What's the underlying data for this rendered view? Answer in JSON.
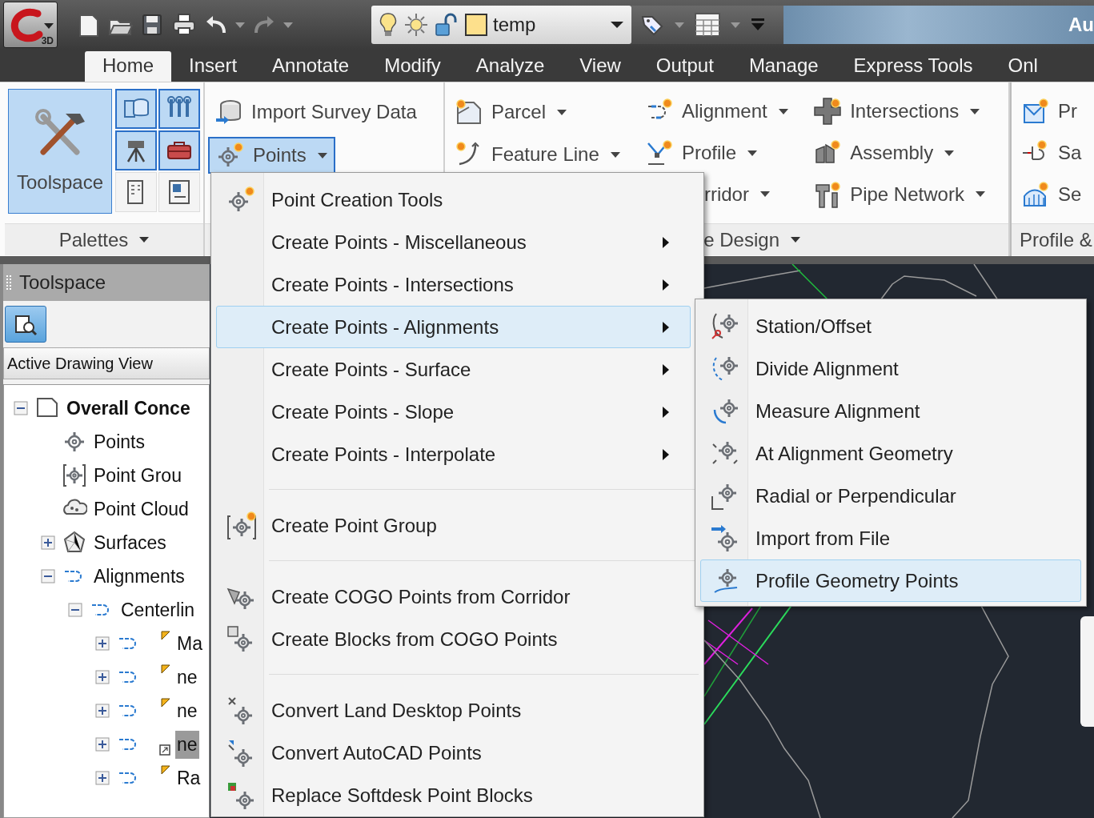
{
  "title_bar": {
    "app_button": {
      "badge": "3D"
    },
    "layer": {
      "name": "temp"
    },
    "title": "Au"
  },
  "ribbon": {
    "tabs": [
      {
        "label": "Home",
        "selected": true
      },
      {
        "label": "Insert",
        "selected": false
      },
      {
        "label": "Annotate",
        "selected": false
      },
      {
        "label": "Modify",
        "selected": false
      },
      {
        "label": "Analyze",
        "selected": false
      },
      {
        "label": "View",
        "selected": false
      },
      {
        "label": "Output",
        "selected": false
      },
      {
        "label": "Manage",
        "selected": false
      },
      {
        "label": "Express Tools",
        "selected": false
      },
      {
        "label": "Onl",
        "selected": false
      }
    ],
    "palettes_panel": {
      "toolspace": {
        "label": "Toolspace",
        "on": true
      },
      "small_buttons": [
        {
          "on": true
        },
        {
          "on": true
        },
        {
          "on": true
        },
        {
          "on": true
        },
        {
          "on": false
        },
        {
          "on": false
        }
      ],
      "title": "Palettes"
    },
    "ground_panel": {
      "tools": [
        {
          "label": "Import Survey Data",
          "dropdown": false,
          "selected": false
        },
        {
          "label": "Points",
          "dropdown": true,
          "selected": true
        }
      ]
    },
    "design_panel": {
      "columns": [
        [
          {
            "label": "Parcel",
            "dropdown": true
          },
          {
            "label": "Feature Line",
            "dropdown": true
          }
        ],
        [
          {
            "label": "Alignment",
            "dropdown": true
          },
          {
            "label": "Profile",
            "dropdown": true
          },
          {
            "label": "rridor",
            "dropdown": true
          }
        ],
        [
          {
            "label": "Intersections",
            "dropdown": true
          },
          {
            "label": "Assembly",
            "dropdown": true
          },
          {
            "label": "Pipe Network",
            "dropdown": true
          }
        ]
      ],
      "title": "e Design"
    },
    "profile_panel": {
      "tools": [
        {
          "label": "Pr"
        },
        {
          "label": "Sa"
        },
        {
          "label": "Se"
        }
      ],
      "title": "Profile &"
    }
  },
  "toolspace": {
    "title": "Toolspace",
    "view": "Active Drawing View",
    "tree": [
      {
        "label": "Overall Conce",
        "kind": "drawing",
        "expanded": true,
        "selected": false,
        "children": [
          {
            "label": "Points",
            "kind": "points",
            "selected": false
          },
          {
            "label": "Point Grou",
            "kind": "point-groups",
            "selected": false
          },
          {
            "label": "Point Cloud",
            "kind": "point-clouds",
            "selected": false
          },
          {
            "label": "Surfaces",
            "kind": "surfaces",
            "expanded": false,
            "selected": false
          },
          {
            "label": "Alignments",
            "kind": "alignments",
            "expanded": true,
            "selected": false,
            "children": [
              {
                "label": "Centerlin",
                "kind": "alignments",
                "expanded": true,
                "selected": false,
                "children": [
                  {
                    "label": "Ma",
                    "kind": "alignment",
                    "expanded": false,
                    "flagged": true,
                    "linked": false,
                    "selected": false
                  },
                  {
                    "label": "ne",
                    "kind": "alignment",
                    "expanded": false,
                    "flagged": true,
                    "linked": false,
                    "selected": false
                  },
                  {
                    "label": "ne",
                    "kind": "alignment",
                    "expanded": false,
                    "flagged": true,
                    "linked": false,
                    "selected": false
                  },
                  {
                    "label": "ne",
                    "kind": "alignment",
                    "expanded": false,
                    "flagged": false,
                    "linked": true,
                    "selected": true
                  },
                  {
                    "label": "Ra",
                    "kind": "alignment",
                    "expanded": false,
                    "flagged": true,
                    "linked": false,
                    "selected": false
                  }
                ]
              }
            ]
          }
        ]
      }
    ]
  },
  "points_menu": {
    "items": [
      {
        "label": "Point Creation Tools",
        "kind": "command",
        "selected": false
      },
      {
        "label": "Create Points - Miscellaneous",
        "kind": "submenu",
        "selected": false
      },
      {
        "label": "Create Points - Intersections",
        "kind": "submenu",
        "selected": false
      },
      {
        "label": "Create Points - Alignments",
        "kind": "submenu",
        "selected": true
      },
      {
        "label": "Create Points - Surface",
        "kind": "submenu",
        "selected": false
      },
      {
        "label": "Create Points - Slope",
        "kind": "submenu",
        "selected": false
      },
      {
        "label": "Create Points - Interpolate",
        "kind": "submenu",
        "selected": false
      },
      {
        "kind": "separator"
      },
      {
        "label": "Create Point Group",
        "kind": "command",
        "selected": false
      },
      {
        "kind": "separator"
      },
      {
        "label": "Create COGO Points from Corridor",
        "kind": "command",
        "selected": false
      },
      {
        "label": "Create Blocks from COGO Points",
        "kind": "command",
        "selected": false
      },
      {
        "kind": "separator"
      },
      {
        "label": "Convert Land Desktop Points",
        "kind": "command",
        "selected": false
      },
      {
        "label": "Convert AutoCAD Points",
        "kind": "command",
        "selected": false
      },
      {
        "label": "Replace Softdesk Point Blocks",
        "kind": "command",
        "selected": false
      }
    ]
  },
  "alignments_submenu": {
    "items": [
      {
        "label": "Station/Offset",
        "selected": false
      },
      {
        "label": "Divide Alignment",
        "selected": false
      },
      {
        "label": "Measure Alignment",
        "selected": false
      },
      {
        "label": "At Alignment Geometry",
        "selected": false
      },
      {
        "label": "Radial or Perpendicular",
        "selected": false
      },
      {
        "label": "Import from File",
        "selected": false
      },
      {
        "label": "Profile Geometry Points",
        "selected": true
      }
    ]
  }
}
